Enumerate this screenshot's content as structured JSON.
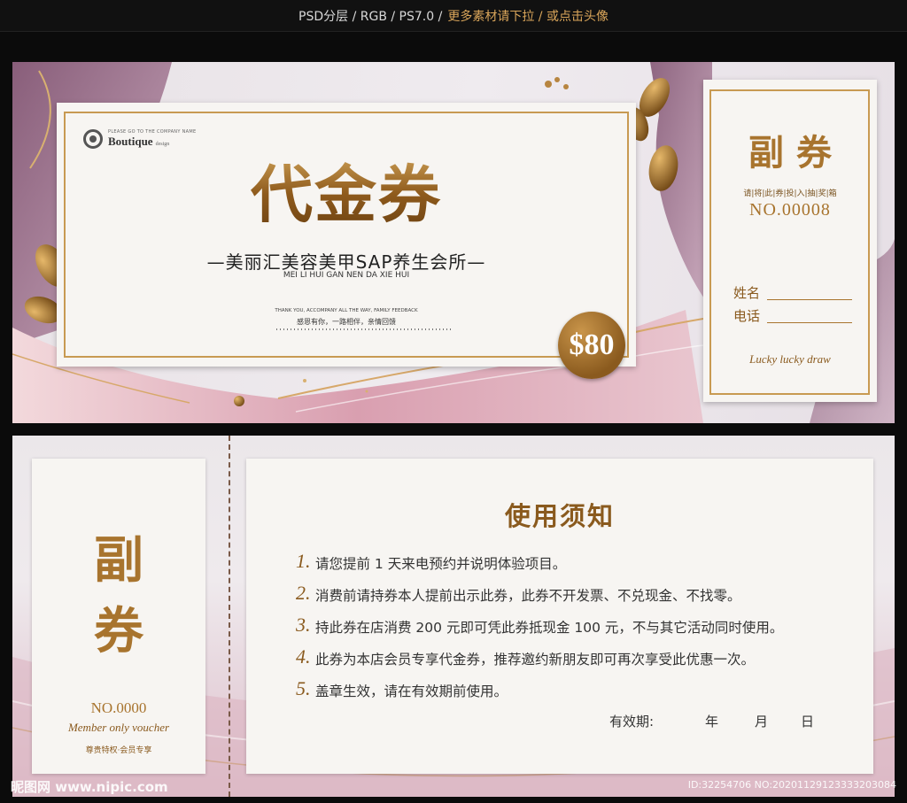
{
  "header": {
    "info": "PSD分层 / RGB / PS7.0 /",
    "more": "更多素材请下拉 / 或点击头像"
  },
  "front": {
    "logo_tagline": "PLEASE GO TO THE COMPANY NAME",
    "logo_name": "Boutique",
    "logo_sub": "design",
    "title": "代金券",
    "subtitle": "—美丽汇美容美甲SAP养生会所—",
    "subtitle_en": "MEI LI HUI GAN NEN DA XIE HUI",
    "thanks_en": "THANK YOU, ACCOMPANY ALL THE WAY, FAMILY FEEDBACK",
    "thanks_cn": "感恩有你，一路相伴，亲情回馈",
    "price": "$80",
    "stub": {
      "title": "副券",
      "fields": "请|将|此|券|投|入|抽|奖|箱",
      "number": "NO.00008",
      "name_label": "姓名",
      "phone_label": "电话",
      "lucky": "Lucky lucky draw"
    }
  },
  "back": {
    "stub": {
      "char1": "副",
      "char2": "券",
      "number": "NO.0000",
      "member_en": "Member only voucher",
      "member_cn": "尊贵特权·会员专享"
    },
    "notice": {
      "title": "使用须知",
      "rules": [
        {
          "num": "1.",
          "text": "请您提前 1 天来电预约并说明体验项目。"
        },
        {
          "num": "2.",
          "text": "消费前请持券本人提前出示此券，此券不开发票、不兑现金、不找零。"
        },
        {
          "num": "3.",
          "text": "持此券在店消费 200 元即可凭此券抵现金 100 元，不与其它活动同时使用。"
        },
        {
          "num": "4.",
          "text": "此券为本店会员专享代金券，推荐邀约新朋友即可再次享受此优惠一次。"
        },
        {
          "num": "5.",
          "text": "盖章生效，请在有效期前使用。"
        }
      ],
      "validity_label": "有效期:",
      "year": "年",
      "month": "月",
      "day": "日"
    }
  },
  "watermark": {
    "left": "昵图网 www.nipic.com",
    "right": "ID:32254706 NO:20201129123333203084"
  },
  "colors": {
    "gold": "#a8742e",
    "gold_light": "#c89a52",
    "paper": "#f7f5f2",
    "purple": "#9a6a86",
    "pink": "#d9aab8"
  }
}
